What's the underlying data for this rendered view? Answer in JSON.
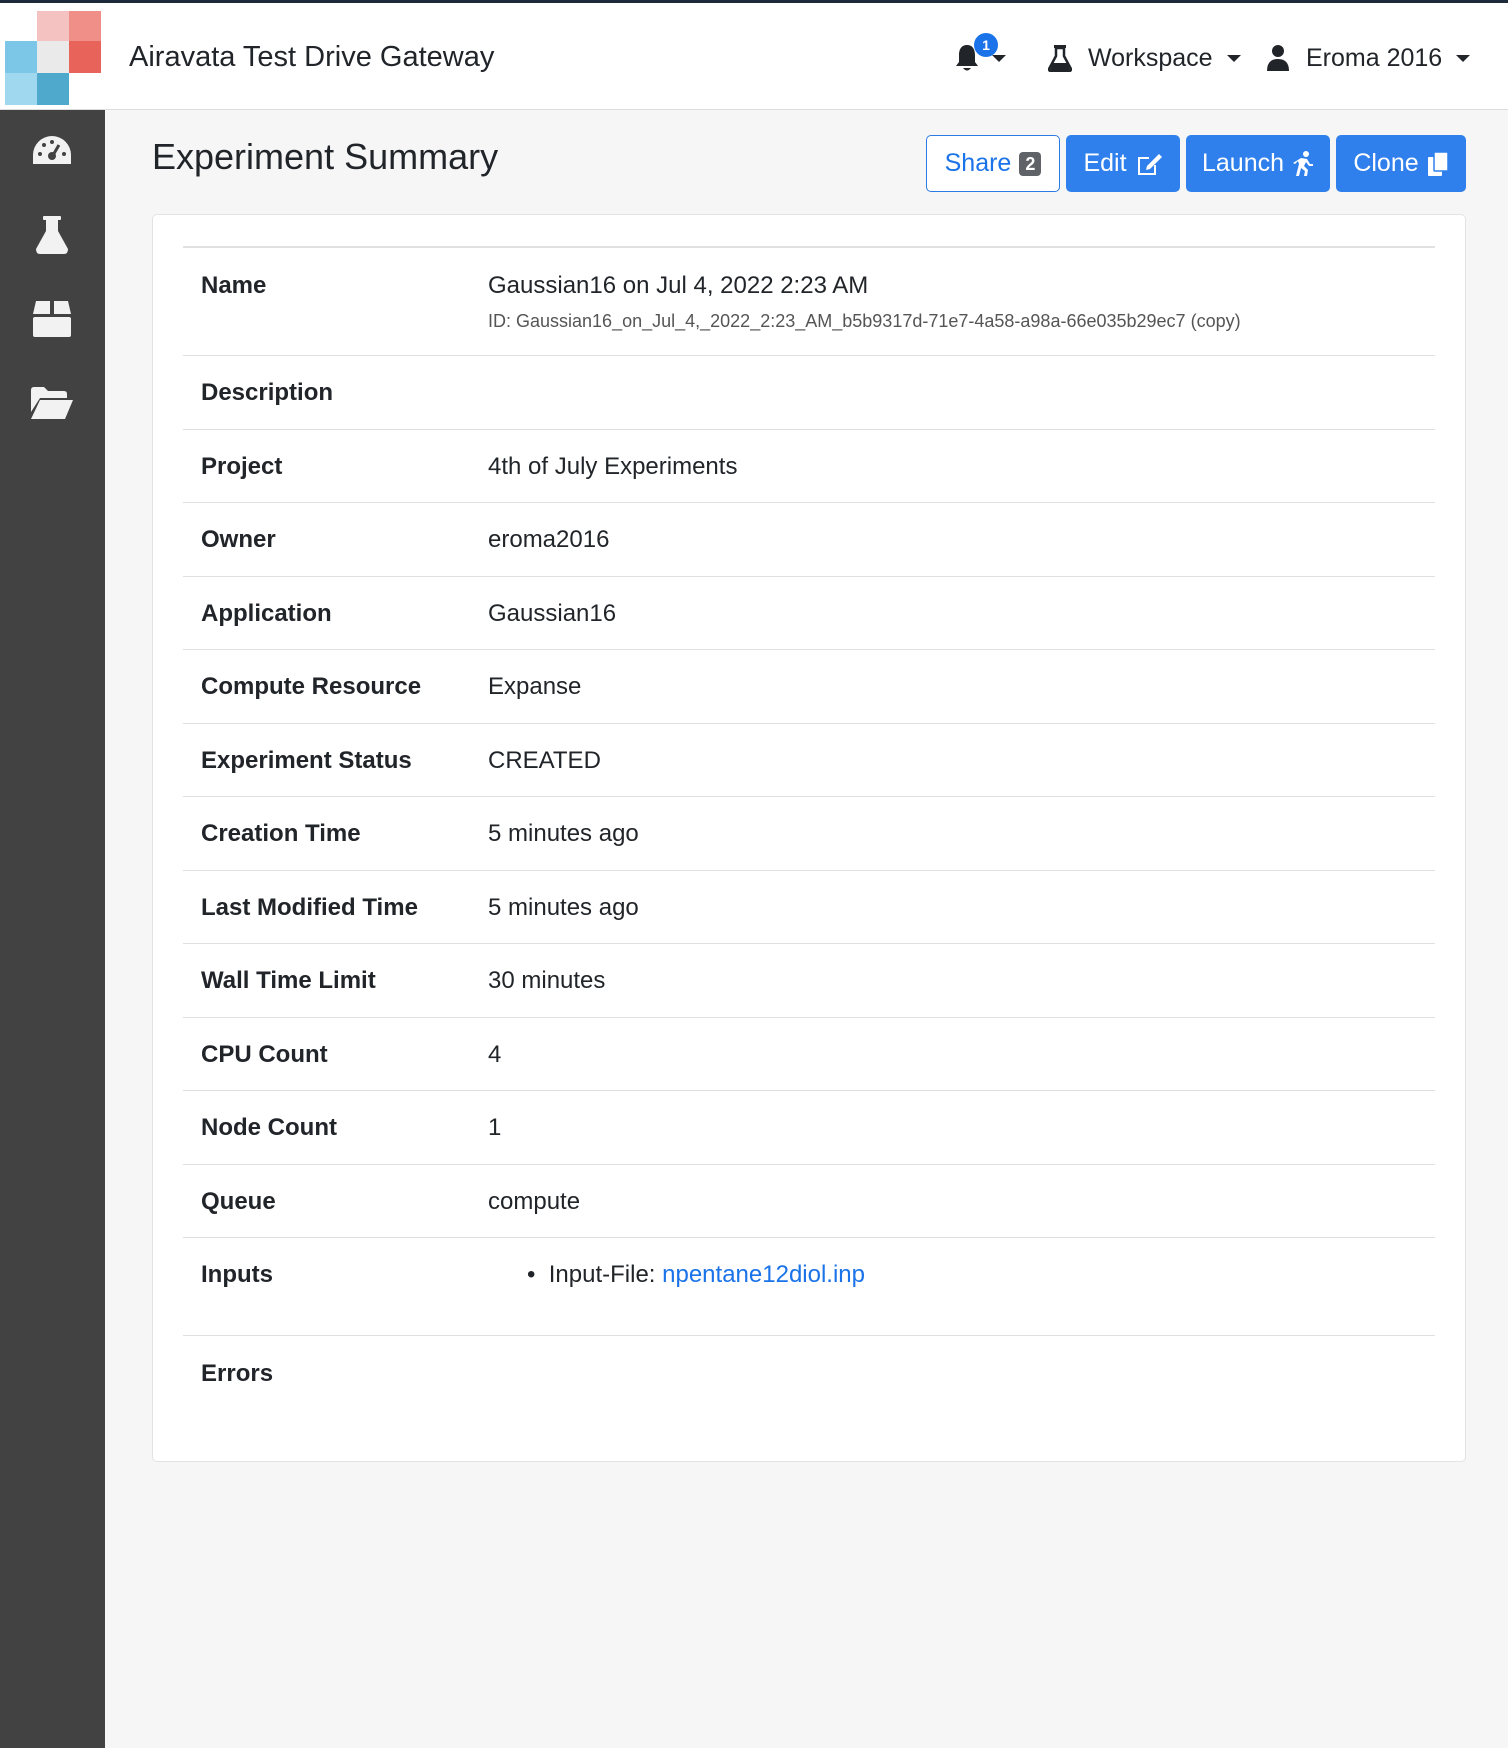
{
  "app": {
    "title": "Airavata Test Drive Gateway",
    "accent_color": "#2f80ed"
  },
  "header": {
    "notifications": {
      "icon": "bell-icon",
      "count": "1"
    },
    "workspace": {
      "icon": "flask-icon",
      "label": "Workspace"
    },
    "user": {
      "icon": "user-icon",
      "label": "Eroma 2016"
    }
  },
  "sidebar": {
    "items": [
      {
        "icon": "dashboard-icon"
      },
      {
        "icon": "flask-icon"
      },
      {
        "icon": "box-icon"
      },
      {
        "icon": "folder-open-icon"
      }
    ]
  },
  "page": {
    "title": "Experiment Summary",
    "actions": {
      "share_label": "Share",
      "share_count": "2",
      "edit_label": "Edit",
      "launch_label": "Launch",
      "clone_label": "Clone"
    }
  },
  "summary": {
    "name_label": "Name",
    "name_value": "Gaussian16 on Jul 4, 2022 2:23 AM",
    "name_id": "ID: Gaussian16_on_Jul_4,_2022_2:23_AM_b5b9317d-71e7-4a58-a98a-66e035b29ec7 (copy)",
    "description_label": "Description",
    "project_label": "Project",
    "project_value": "4th of July Experiments",
    "owner_label": "Owner",
    "owner_value": "eroma2016",
    "application_label": "Application",
    "application_value": "Gaussian16",
    "compute_label": "Compute Resource",
    "compute_value": "Expanse",
    "status_label": "Experiment Status",
    "status_value": "CREATED",
    "creation_label": "Creation Time",
    "creation_value": "5 minutes ago",
    "modified_label": "Last Modified Time",
    "modified_value": "5 minutes ago",
    "walltime_label": "Wall Time Limit",
    "walltime_value": "30 minutes",
    "cpu_label": "CPU Count",
    "cpu_value": "4",
    "node_label": "Node Count",
    "node_value": "1",
    "queue_label": "Queue",
    "queue_value": "compute",
    "inputs_label": "Inputs",
    "input_name": "Input-File:",
    "input_file": "npentane12diol.inp",
    "errors_label": "Errors"
  }
}
